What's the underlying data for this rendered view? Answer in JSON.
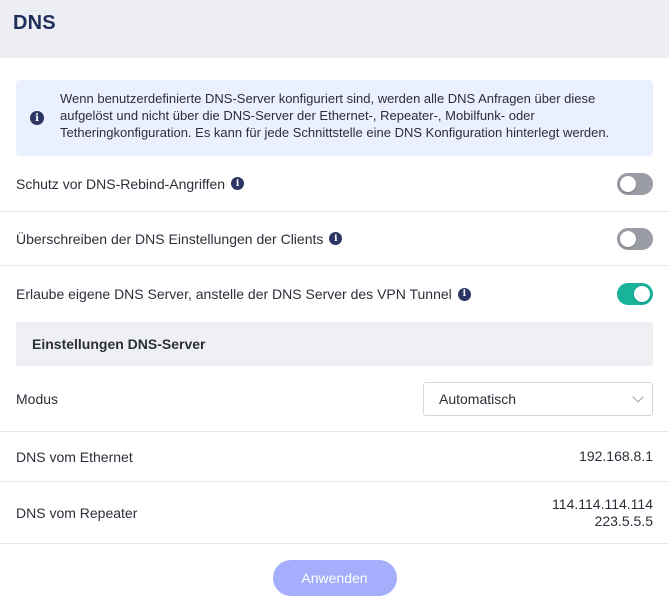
{
  "header": {
    "title": "DNS"
  },
  "info": {
    "line1": "Wenn benutzerdefinierte DNS-Server konfiguriert sind, werden alle DNS Anfragen über diese",
    "line2": "aufgelöst und nicht über die DNS-Server der Ethernet-, Repeater-, Mobilfunk- oder",
    "line3": "Tetheringkonfiguration. Es kann für jede Schnittstelle eine DNS Konfiguration hinterlegt werden."
  },
  "toggles": [
    {
      "label": "Schutz vor DNS-Rebind-Angriffen",
      "state": "off"
    },
    {
      "label": "Überschreiben der DNS Einstellungen der Clients",
      "state": "off"
    },
    {
      "label": "Erlaube eigene DNS Server, anstelle der DNS Server des VPN Tunnel",
      "state": "on"
    }
  ],
  "section": {
    "title": "Einstellungen DNS-Server"
  },
  "mode": {
    "label": "Modus",
    "selected": "Automatisch"
  },
  "ethernet": {
    "label": "DNS vom Ethernet",
    "value": "192.168.8.1"
  },
  "repeater": {
    "label": "DNS vom Repeater",
    "values": [
      "114.114.114.114",
      "223.5.5.5"
    ]
  },
  "apply": {
    "label": "Anwenden"
  },
  "colors": {
    "accent_on": "#19b39b",
    "toggle_off": "#9a9ca3",
    "button": "#a4aefc",
    "title": "#1f2d5a"
  }
}
